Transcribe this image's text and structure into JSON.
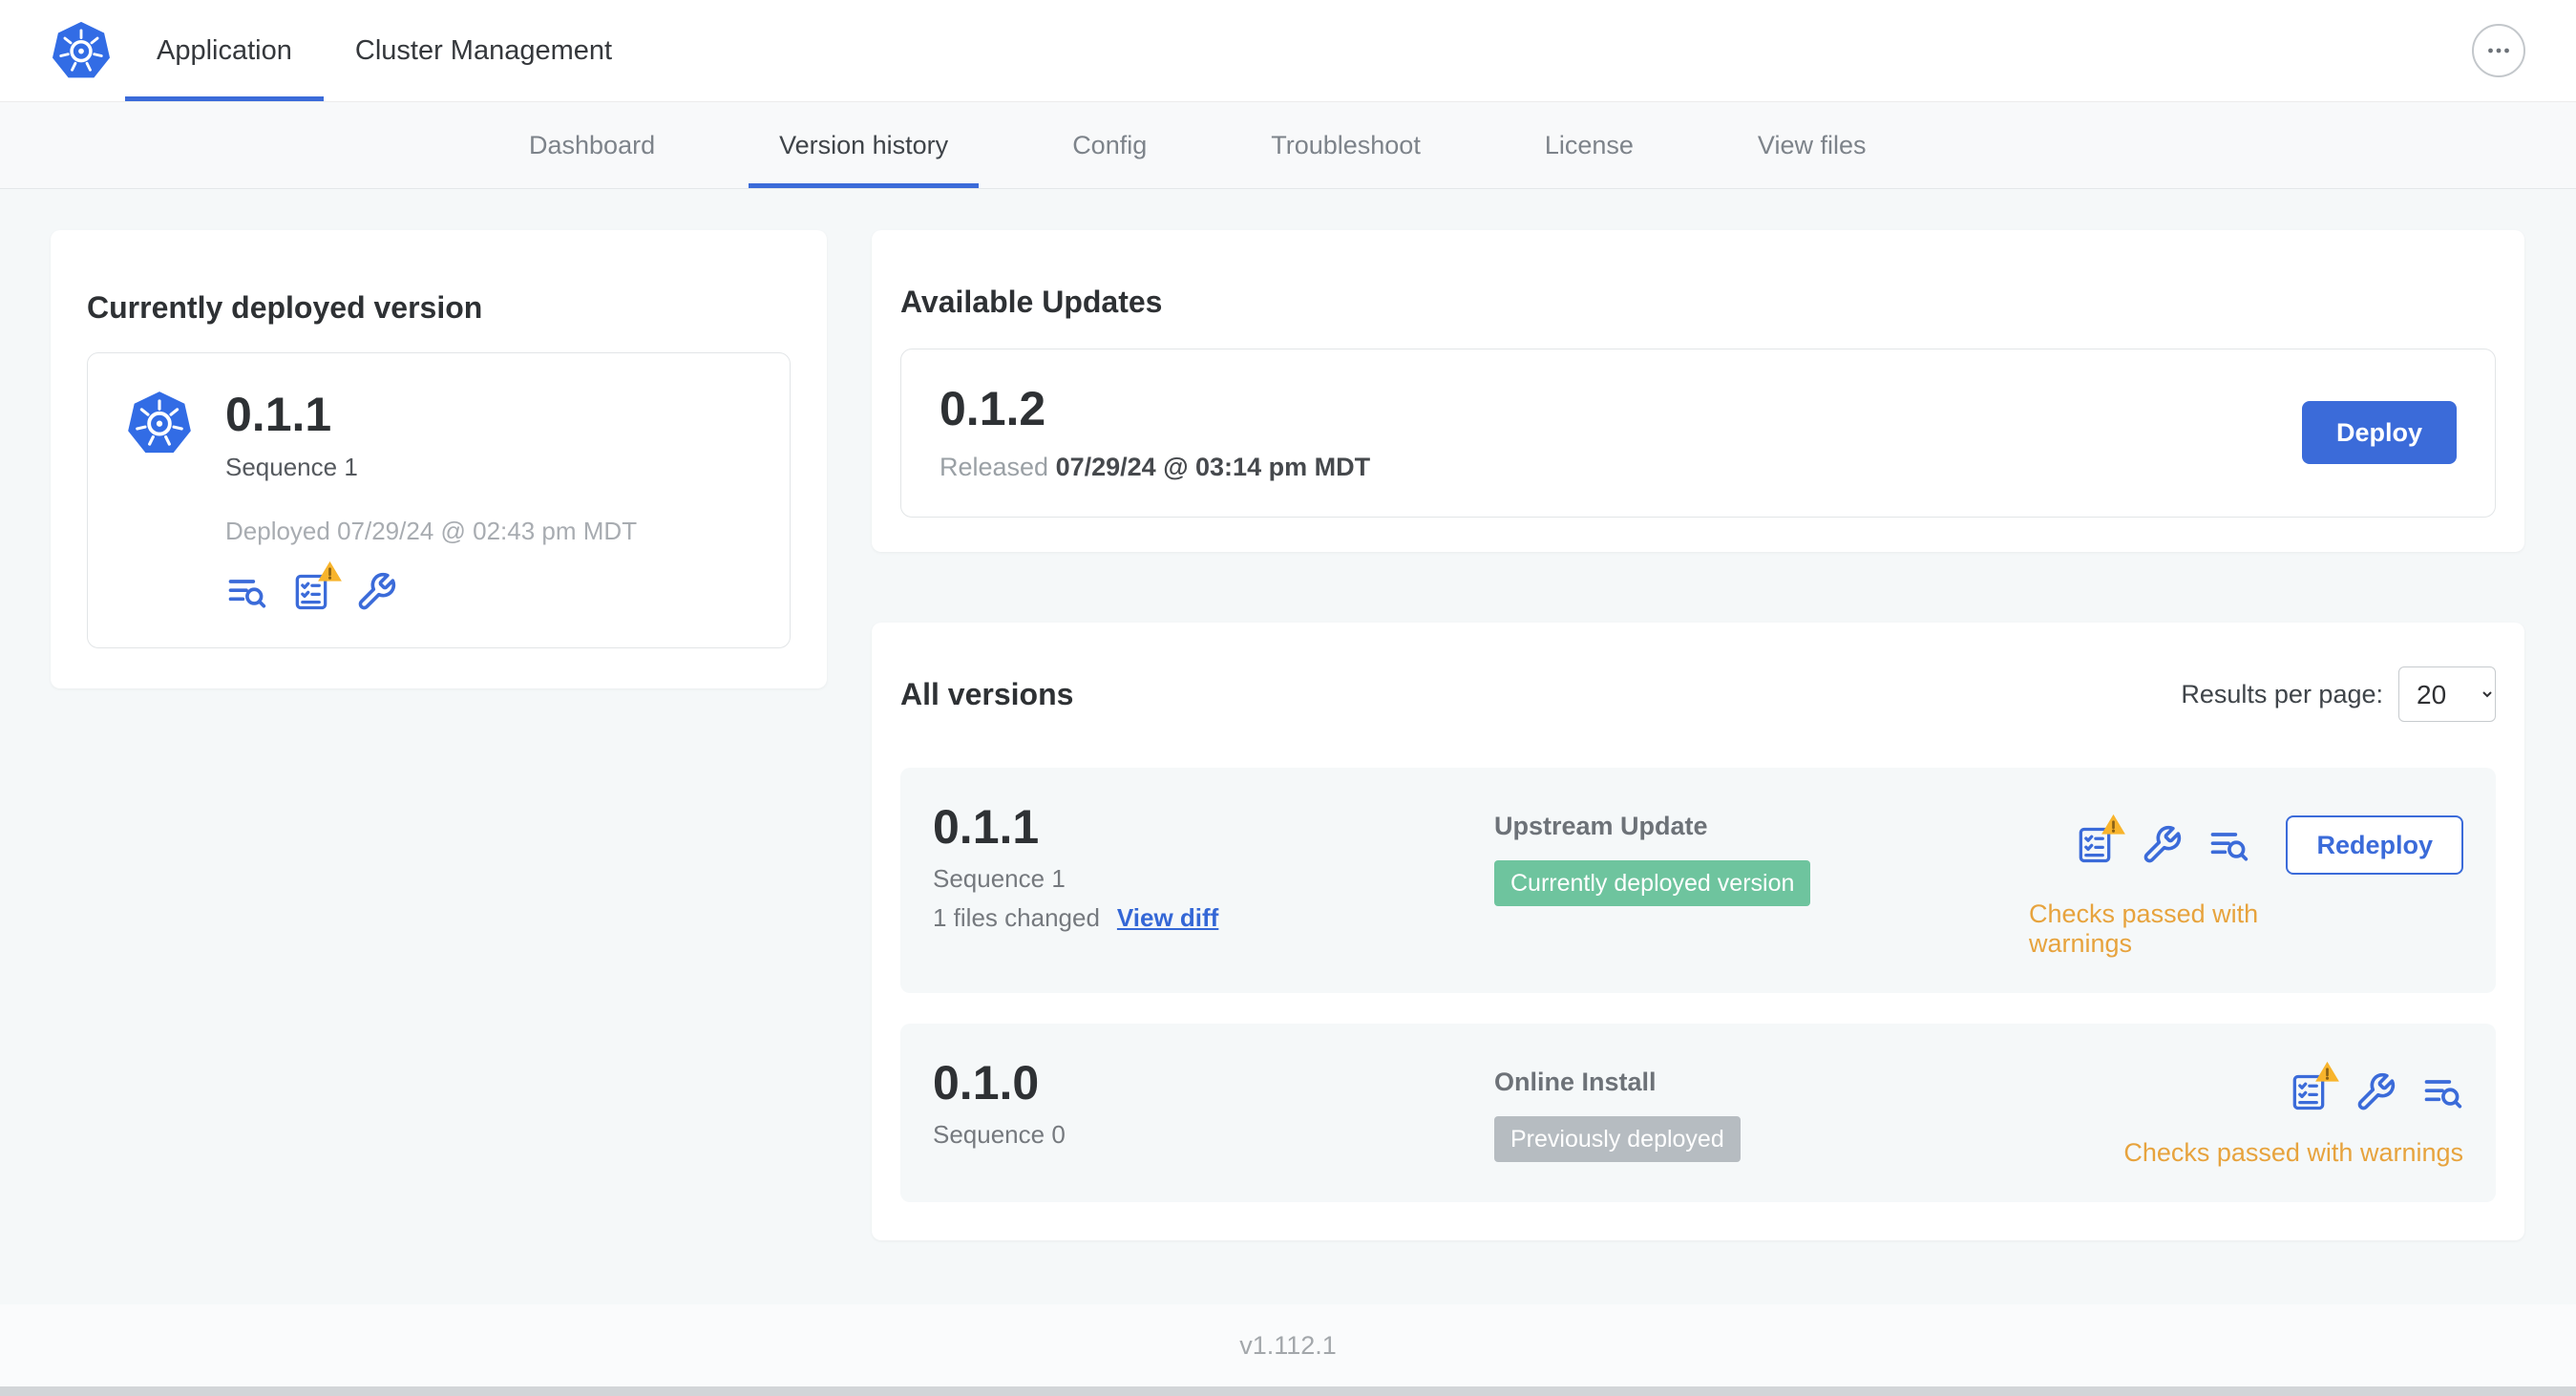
{
  "header": {
    "tabs": [
      "Application",
      "Cluster Management"
    ]
  },
  "nav": {
    "items": [
      "Dashboard",
      "Version history",
      "Config",
      "Troubleshoot",
      "License",
      "View files"
    ],
    "active": "Version history"
  },
  "current": {
    "title": "Currently deployed version",
    "version": "0.1.1",
    "sequence": "Sequence 1",
    "deployed": "Deployed 07/29/24 @ 02:43 pm MDT"
  },
  "available": {
    "title": "Available Updates",
    "version": "0.1.2",
    "released_prefix": "Released",
    "released_date": "07/29/24 @ 03:14 pm MDT",
    "deploy_label": "Deploy"
  },
  "all_versions": {
    "title": "All versions",
    "results_per_page_label": "Results per page:",
    "results_per_page_value": "20",
    "rows": [
      {
        "version": "0.1.1",
        "sequence": "Sequence 1",
        "files_changed": "1 files changed",
        "view_diff": "View diff",
        "source": "Upstream Update",
        "badge": "Currently deployed version",
        "badge_type": "green",
        "action": "Redeploy",
        "status": "Checks passed with warnings"
      },
      {
        "version": "0.1.0",
        "sequence": "Sequence 0",
        "source": "Online Install",
        "badge": "Previously deployed",
        "badge_type": "gray",
        "status": "Checks passed with warnings"
      }
    ]
  },
  "footer": {
    "version": "v1.112.1"
  },
  "colors": {
    "accent_blue": "#3b6bd9",
    "k8s_blue": "#326ce5",
    "badge_green": "#6ec49e",
    "badge_gray": "#b6bcc1",
    "warning_text": "#e7a33d",
    "warning_triangle": "#f8b42c",
    "page_background": "#f5f8f9"
  }
}
